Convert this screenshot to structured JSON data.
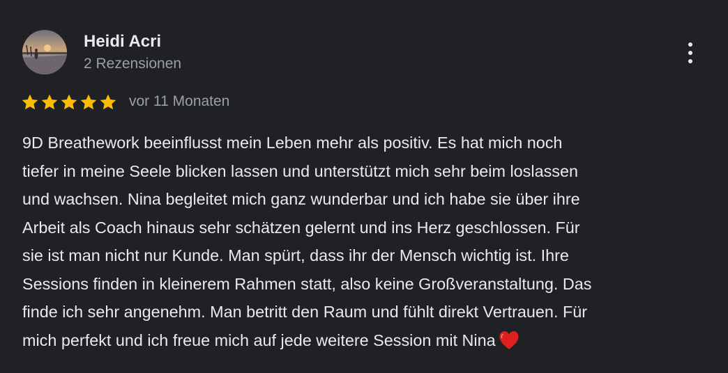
{
  "review": {
    "author": {
      "name": "Heidi Acri",
      "review_count": "2 Rezensionen",
      "avatar_icon": "profile-photo"
    },
    "rating": {
      "stars": 5,
      "max": 5,
      "color": "#fbbc04"
    },
    "date": "vor 11 Monaten",
    "text_lines": [
      "9D Breathework beeinflusst mein Leben mehr als positiv. Es hat mich noch",
      "tiefer in meine Seele blicken lassen und unterstützt mich sehr beim loslassen",
      "und wachsen. Nina begleitet mich ganz wunderbar und ich habe sie über ihre",
      "Arbeit als Coach hinaus sehr schätzen gelernt und ins Herz geschlossen. Für",
      "sie ist man nicht nur Kunde. Man spürt, dass ihr der Mensch wichtig ist. Ihre",
      "Sessions finden in kleinerem Rahmen statt, also keine Großveranstaltung. Das",
      "finde ich sehr angenehm. Man betritt den Raum und fühlt direkt Vertrauen. Für",
      "mich perfekt und ich freue mich auf jede weitere Session mit Nina"
    ],
    "trailing_icon": "red-heart-emoji",
    "more_options_icon": "more-vertical-icon"
  },
  "theme": {
    "background": "#202124",
    "text_primary": "#e8eaed",
    "text_secondary": "#9aa0a6",
    "heart_color": "#e0201e"
  }
}
